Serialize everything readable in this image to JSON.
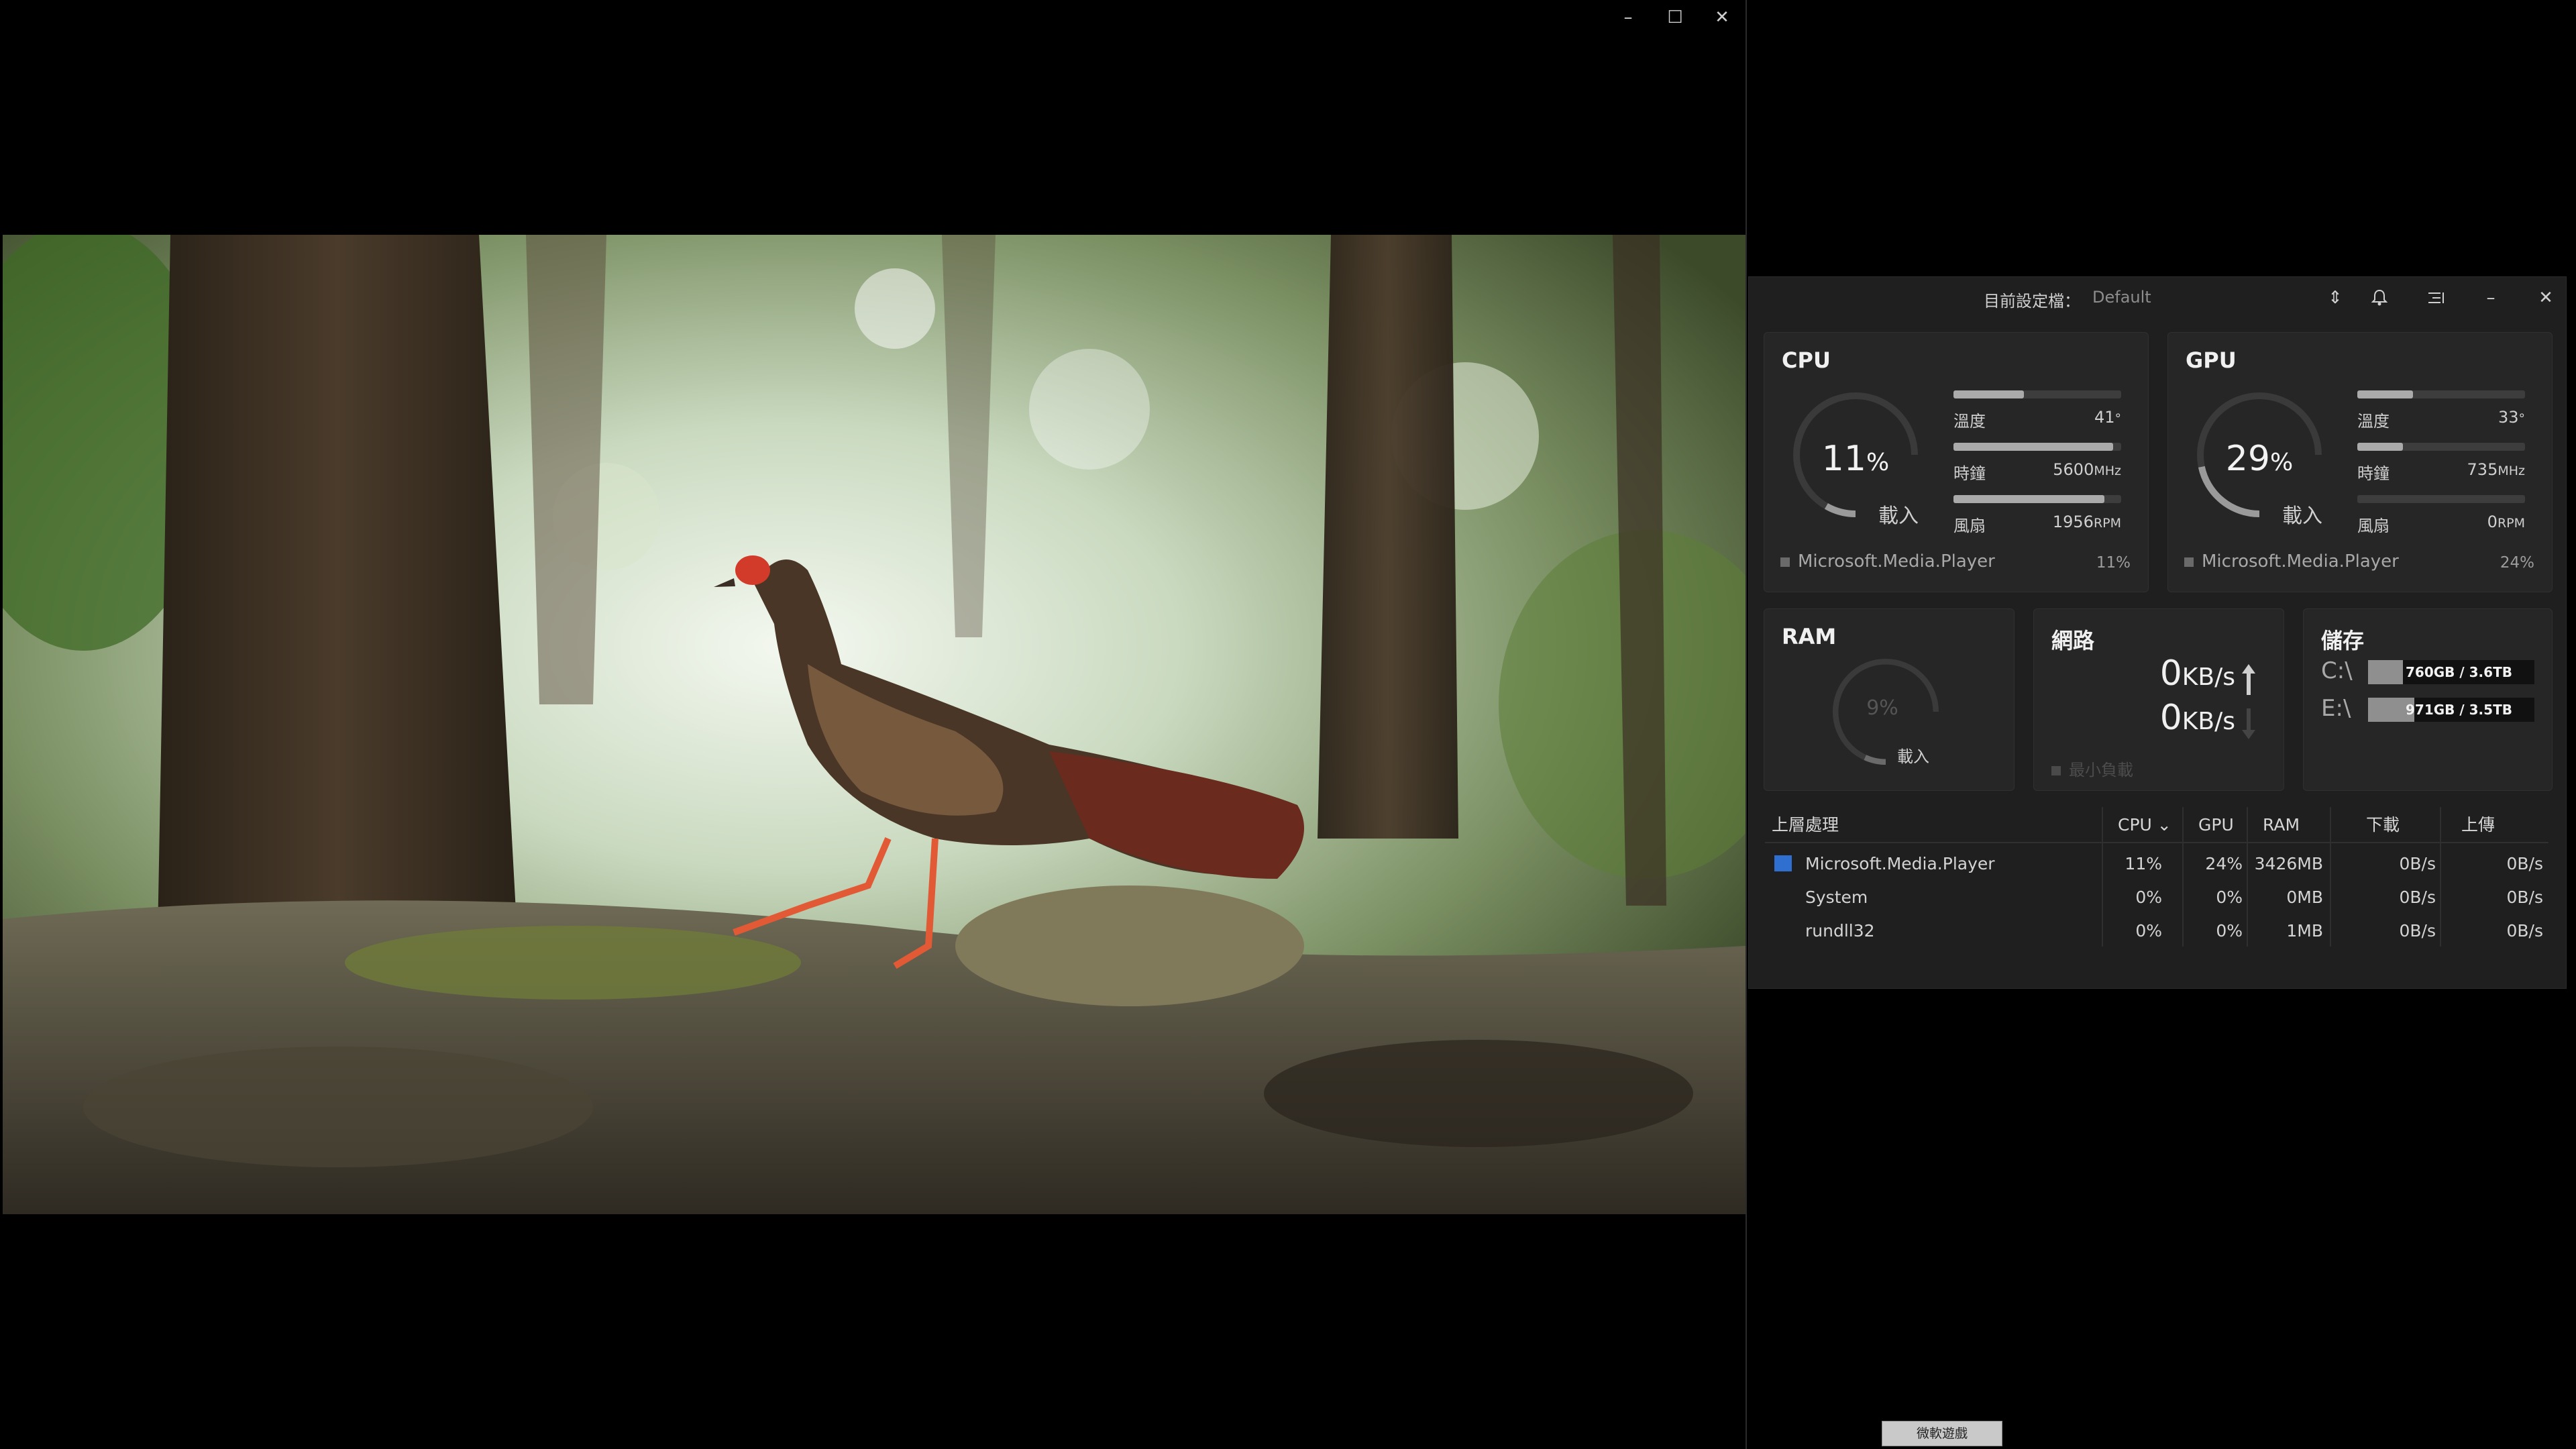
{
  "player": {
    "minimize_icon": "–",
    "maximize_icon": "☐",
    "close_icon": "✕"
  },
  "monitor": {
    "profile_label": "目前設定檔：",
    "profile_value": "Default",
    "header_icons": {
      "sort": "⇕",
      "bell": "🔔",
      "list": "☰",
      "minimize": "–",
      "close": "✕"
    },
    "cpu": {
      "title": "CPU",
      "load_value": "11",
      "load_unit": "%",
      "load_label": "載入",
      "load_fraction": 0.11,
      "stats": [
        {
          "label": "溫度",
          "value": "41",
          "unit": "°",
          "fill": 0.42
        },
        {
          "label": "時鐘",
          "value": "5600",
          "unit": "MHz",
          "fill": 0.95
        },
        {
          "label": "風扇",
          "value": "1956",
          "unit": "RPM",
          "fill": 0.9
        }
      ],
      "top_process": "Microsoft.Media.Player",
      "top_process_pct": "11%"
    },
    "gpu": {
      "title": "GPU",
      "load_value": "29",
      "load_unit": "%",
      "load_label": "載入",
      "load_fraction": 0.29,
      "stats": [
        {
          "label": "溫度",
          "value": "33",
          "unit": "°",
          "fill": 0.33
        },
        {
          "label": "時鐘",
          "value": "735",
          "unit": "MHz",
          "fill": 0.27
        },
        {
          "label": "風扇",
          "value": "0",
          "unit": "RPM",
          "fill": 0.0
        }
      ],
      "top_process": "Microsoft.Media.Player",
      "top_process_pct": "24%"
    },
    "ram": {
      "title": "RAM",
      "load_value": "9",
      "load_unit": "%",
      "load_label": "載入",
      "load_fraction": 0.09
    },
    "network": {
      "title": "網路",
      "upload_value": "0",
      "download_value": "0",
      "unit": "KB/s",
      "footer": "最小負載"
    },
    "storage": {
      "title": "儲存",
      "drives": [
        {
          "label": "C:\\",
          "text": "760GB / 3.6TB",
          "fill": 0.21
        },
        {
          "label": "E:\\",
          "text": "971GB / 3.5TB",
          "fill": 0.28
        }
      ]
    },
    "processes": {
      "headers": {
        "name": "上層處理",
        "cpu": "CPU",
        "gpu": "GPU",
        "ram": "RAM",
        "down": "下載",
        "up": "上傳"
      },
      "rows": [
        {
          "name": "Microsoft.Media.Player",
          "cpu": "11%",
          "gpu": "24%",
          "ram": "3426MB",
          "down": "0B/s",
          "up": "0B/s"
        },
        {
          "name": "System",
          "cpu": "0%",
          "gpu": "0%",
          "ram": "0MB",
          "down": "0B/s",
          "up": "0B/s"
        },
        {
          "name": "rundll32",
          "cpu": "0%",
          "gpu": "0%",
          "ram": "1MB",
          "down": "0B/s",
          "up": "0B/s"
        }
      ]
    }
  },
  "taskbar": {
    "button_label": "微軟遊戲"
  }
}
